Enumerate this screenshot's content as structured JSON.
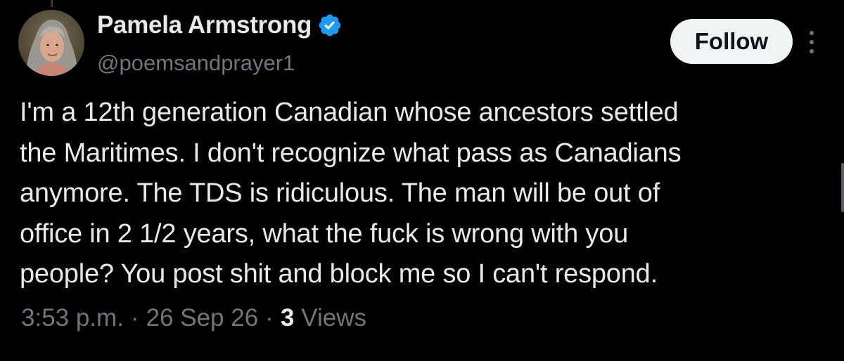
{
  "post": {
    "author": {
      "display_name": "Pamela Armstrong",
      "handle": "@poemsandprayer1",
      "verified_icon": "verified-badge-icon",
      "verified_color": "#1d9bf0"
    },
    "follow_label": "Follow",
    "more_icon": "more-vertical-icon",
    "text": "I'm a 12th generation Canadian whose ancestors settled\nthe Maritimes. I don't recognize what pass as Canadians\nanymore. The TDS is ridiculous. The man will be out of\noffice in 2 1/2 years, what the fuck is wrong with you\npeople? You post shit and block me so I can't respond.",
    "meta": {
      "time": "3:53 p.m.",
      "separator": "·",
      "date": "26 Sep 26",
      "views_count": "3",
      "views_label": "Views"
    }
  },
  "theme": {
    "background": "#000000",
    "primary_text": "#e7e9ea",
    "secondary_text": "#71767b",
    "button_bg": "#eff3f4"
  }
}
